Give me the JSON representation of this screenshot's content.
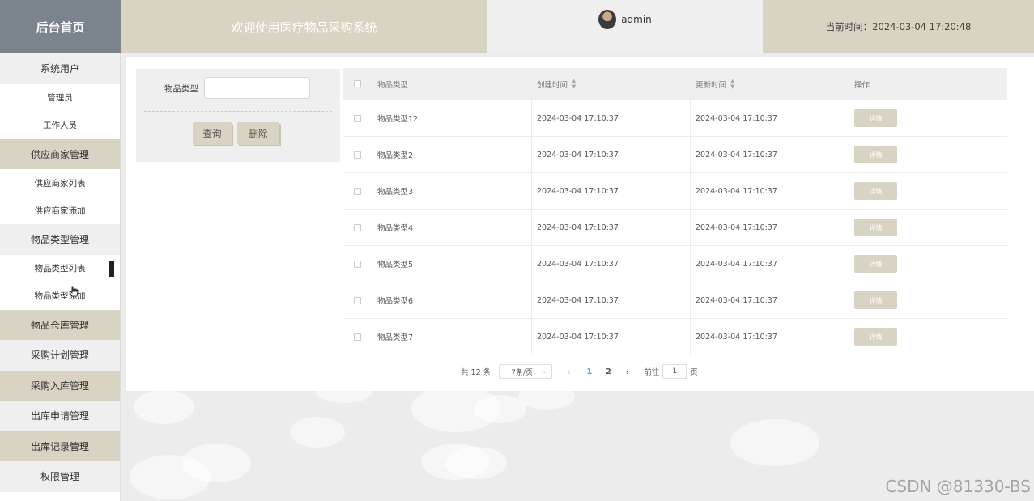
{
  "header": {
    "logo": "后台首页",
    "title": "欢迎使用医疗物品采购系统",
    "user": "admin",
    "time_label": "当前时间：2024-03-04 17:20:48"
  },
  "sidebar": {
    "items": [
      {
        "label": "系统用户",
        "style": "gray"
      },
      {
        "label": "管理员",
        "style": "sub"
      },
      {
        "label": "工作人员",
        "style": "sub"
      },
      {
        "label": "供应商家管理",
        "style": "tan"
      },
      {
        "label": "供应商家列表",
        "style": "sub"
      },
      {
        "label": "供应商家添加",
        "style": "sub"
      },
      {
        "label": "物品类型管理",
        "style": "gray"
      },
      {
        "label": "物品类型列表",
        "style": "sub",
        "active": true
      },
      {
        "label": "物品类型添加",
        "style": "sub"
      },
      {
        "label": "物品仓库管理",
        "style": "tan"
      },
      {
        "label": "采购计划管理",
        "style": "gray"
      },
      {
        "label": "采购入库管理",
        "style": "tan"
      },
      {
        "label": "出库申请管理",
        "style": "gray"
      },
      {
        "label": "出库记录管理",
        "style": "tan"
      },
      {
        "label": "权限管理",
        "style": "gray"
      }
    ]
  },
  "search": {
    "label": "物品类型",
    "value": "",
    "query_button": "查询",
    "delete_button": "删除"
  },
  "table": {
    "headers": {
      "type": "物品类型",
      "created": "创建时间",
      "updated": "更新时间",
      "op": "操作"
    },
    "rows": [
      {
        "type": "物品类型12",
        "created": "2024-03-04 17:10:37",
        "updated": "2024-03-04 17:10:37",
        "action": "详情"
      },
      {
        "type": "物品类型2",
        "created": "2024-03-04 17:10:37",
        "updated": "2024-03-04 17:10:37",
        "action": "详情"
      },
      {
        "type": "物品类型3",
        "created": "2024-03-04 17:10:37",
        "updated": "2024-03-04 17:10:37",
        "action": "详情"
      },
      {
        "type": "物品类型4",
        "created": "2024-03-04 17:10:37",
        "updated": "2024-03-04 17:10:37",
        "action": "详情"
      },
      {
        "type": "物品类型5",
        "created": "2024-03-04 17:10:37",
        "updated": "2024-03-04 17:10:37",
        "action": "详情"
      },
      {
        "type": "物品类型6",
        "created": "2024-03-04 17:10:37",
        "updated": "2024-03-04 17:10:37",
        "action": "详情"
      },
      {
        "type": "物品类型7",
        "created": "2024-03-04 17:10:37",
        "updated": "2024-03-04 17:10:37",
        "action": "详情"
      }
    ]
  },
  "pagination": {
    "total": "共 12 条",
    "page_size": "7条/页",
    "pages": [
      "1",
      "2"
    ],
    "current": "1",
    "goto_label": "前往",
    "goto_value": "1",
    "goto_unit": "页"
  },
  "watermark": "CSDN @81330-BS",
  "colors": {
    "accent_tan": "#d9d3c3",
    "logo_gray": "#7b838d",
    "active_page": "#409eff"
  }
}
